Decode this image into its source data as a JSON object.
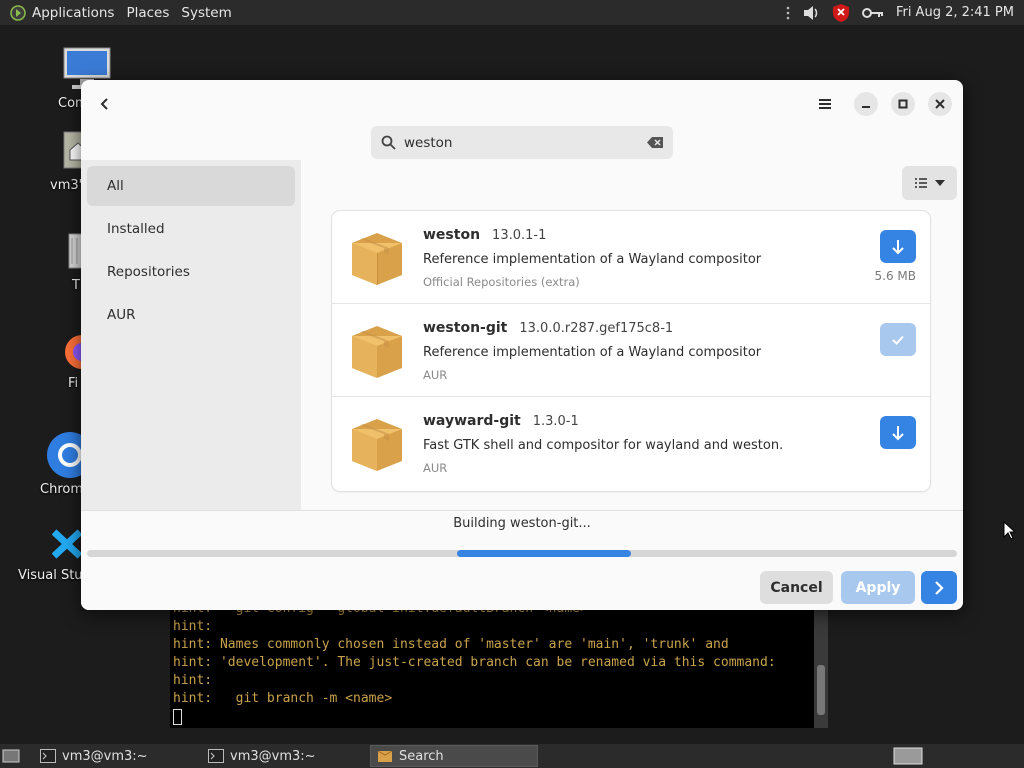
{
  "top_panel": {
    "applications": "Applications",
    "places": "Places",
    "system": "System",
    "clock": "Fri Aug  2,  2:41 PM"
  },
  "desktop": {
    "icons": [
      {
        "label": "Com",
        "icon": "computer-icon"
      },
      {
        "label": "vm3'",
        "icon": "home-folder-icon"
      },
      {
        "label": "T",
        "icon": "trash-icon"
      },
      {
        "label": "Fi",
        "icon": "firefox-icon"
      },
      {
        "label": "Chrom",
        "icon": "chrome-icon"
      },
      {
        "label": "Visual Stud",
        "icon": "vscode-icon"
      }
    ]
  },
  "terminal": {
    "lines": [
      "hint:   git config --global init.defaultBranch <name>",
      "hint:",
      "hint: Names commonly chosen instead of 'master' are 'main', 'trunk' and",
      "hint: 'development'. The just-created branch can be renamed via this command:",
      "hint:",
      "hint:   git branch -m <name>"
    ]
  },
  "dialog": {
    "search": {
      "value": "weston"
    },
    "sidebar": [
      "All",
      "Installed",
      "Repositories",
      "AUR"
    ],
    "packages": [
      {
        "name": "weston",
        "version": "13.0.1-1",
        "description": "Reference implementation of a Wayland compositor",
        "repo": "Official Repositories (extra)",
        "size": "5.6 MB",
        "state": "install"
      },
      {
        "name": "weston-git",
        "version": "13.0.0.r287.gef175c8-1",
        "description": "Reference implementation of a Wayland compositor",
        "repo": "AUR",
        "size": "",
        "state": "selected"
      },
      {
        "name": "wayward-git",
        "version": "1.3.0-1",
        "description": "Fast GTK shell and compositor for wayland and weston.",
        "repo": "AUR",
        "size": "",
        "state": "install"
      }
    ],
    "status": "Building weston-git...",
    "progress_fraction": 0.2,
    "cancel": "Cancel",
    "apply": "Apply"
  },
  "taskbar": {
    "tasks": [
      {
        "label": "vm3@vm3:~",
        "active": false
      },
      {
        "label": "vm3@vm3:~",
        "active": false
      },
      {
        "label": "Search",
        "active": true
      }
    ]
  },
  "colors": {
    "accent": "#3584e4",
    "accent_disabled": "#a9c8ee"
  }
}
